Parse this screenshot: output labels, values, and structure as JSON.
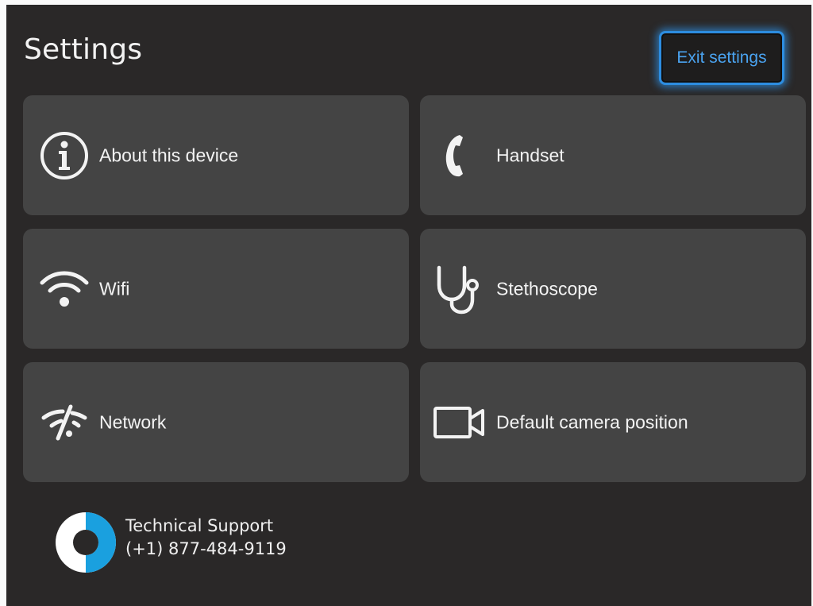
{
  "header": {
    "title": "Settings",
    "exit_label": "Exit settings"
  },
  "tiles": [
    {
      "label": "About this device",
      "icon": "info-icon"
    },
    {
      "label": "Handset",
      "icon": "phone-handset-icon"
    },
    {
      "label": "Wifi",
      "icon": "wifi-icon"
    },
    {
      "label": "Stethoscope",
      "icon": "stethoscope-icon"
    },
    {
      "label": "Network",
      "icon": "network-disconnected-icon"
    },
    {
      "label": "Default camera position",
      "icon": "video-camera-icon"
    }
  ],
  "support": {
    "title": "Technical Support",
    "phone": "(+1) 877-484-9119",
    "logo_icon": "support-logo-icon"
  },
  "colors": {
    "background": "#2a2828",
    "tile": "#444444",
    "accent": "#2d8de0",
    "logo_blue": "#1aa0df"
  }
}
